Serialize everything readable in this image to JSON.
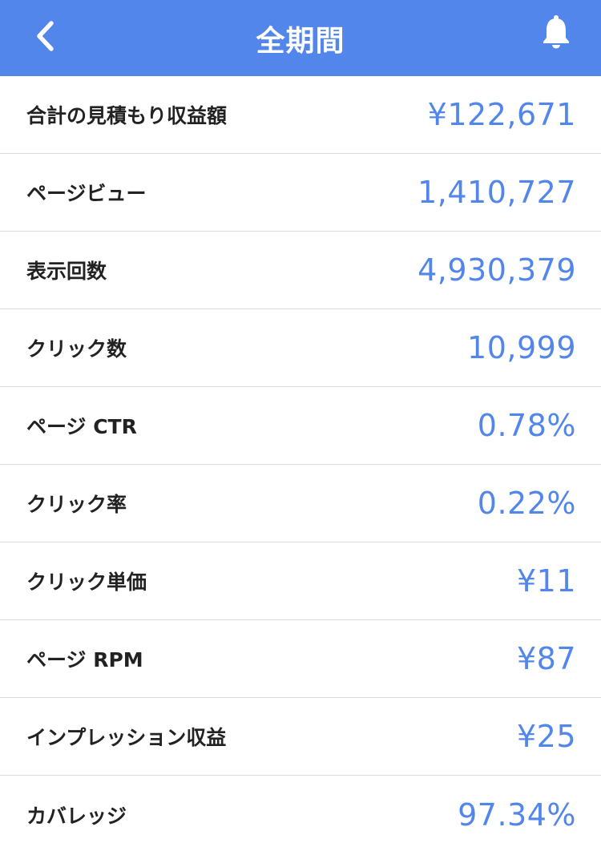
{
  "header": {
    "title": "全期間",
    "back_icon": "chevron-left-icon",
    "notification_icon": "bell-icon",
    "background_color": "#5286ea"
  },
  "accent_color": "#5286ea",
  "metrics": [
    {
      "label": "合計の見積もり収益額",
      "value": "¥122,671"
    },
    {
      "label": "ページビュー",
      "value": "1,410,727"
    },
    {
      "label": "表示回数",
      "value": "4,930,379"
    },
    {
      "label": "クリック数",
      "value": "10,999"
    },
    {
      "label": "ページ CTR",
      "value": "0.78%"
    },
    {
      "label": "クリック率",
      "value": "0.22%"
    },
    {
      "label": "クリック単価",
      "value": "¥11"
    },
    {
      "label": "ページ RPM",
      "value": "¥87"
    },
    {
      "label": "インプレッション収益",
      "value": "¥25"
    },
    {
      "label": "カバレッジ",
      "value": "97.34%"
    }
  ]
}
